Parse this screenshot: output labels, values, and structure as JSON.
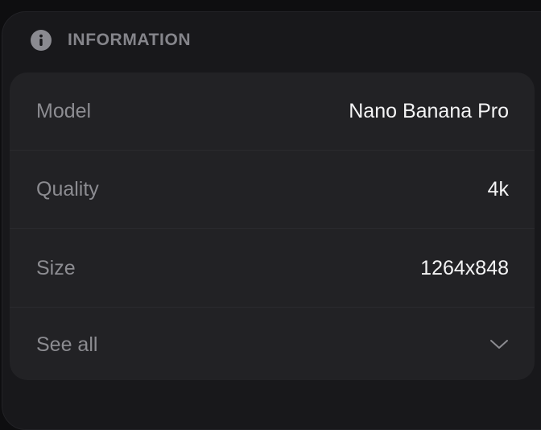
{
  "section": {
    "icon": "info-icon",
    "title": "INFORMATION"
  },
  "rows": [
    {
      "label": "Model",
      "value": "Nano Banana Pro"
    },
    {
      "label": "Quality",
      "value": "4k"
    },
    {
      "label": "Size",
      "value": "1264x848"
    }
  ],
  "see_all": {
    "label": "See all",
    "icon": "chevron-down-icon"
  },
  "colors": {
    "background": "#0e0e10",
    "panel": "#18181b",
    "card": "#222225",
    "label_text": "#8c8c91",
    "value_text": "#f4f4f5"
  }
}
